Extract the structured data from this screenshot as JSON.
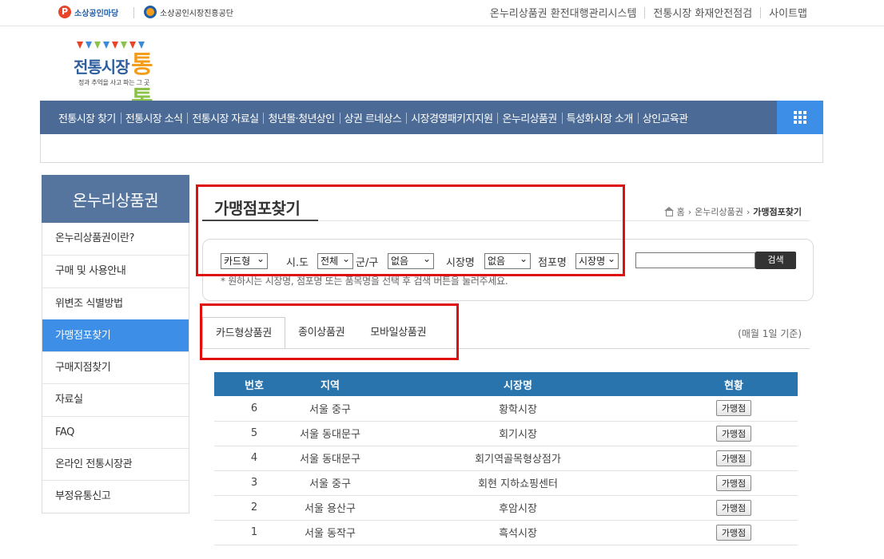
{
  "topbar": {
    "logo_a": "소상공인마당",
    "logo_b": "소상공인시장진흥공단",
    "links": [
      "온누리상품권 환전대행관리시스템",
      "전통시장 화재안전점검",
      "사이트맵"
    ]
  },
  "brand": {
    "name_a": "전통시장",
    "name_b1": "통",
    "name_b2": "통",
    "tagline": "정과 추억을 사고 파는 그 곳"
  },
  "gnb": {
    "items": [
      "전통시장 찾기",
      "전통시장 소식",
      "전통시장 자료실",
      "청년몰·청년상인",
      "상권 르네상스",
      "시장경영패키지지원",
      "온누리상품권",
      "특성화시장 소개",
      "상인교육관"
    ]
  },
  "lnb": {
    "title": "온누리상품권",
    "items": [
      "온누리상품권이란?",
      "구매 및 사용안내",
      "위변조 식별방법",
      "가맹점포찾기",
      "구매지점찾기",
      "자료실",
      "FAQ",
      "온라인 전통시장관",
      "부정유통신고"
    ],
    "active_index": 3
  },
  "page": {
    "title": "가맹점포찾기",
    "breadcrumb": {
      "home": "홈",
      "parent": "온누리상품권",
      "current": "가맹점포찾기"
    }
  },
  "search": {
    "type_value": "카드형",
    "sido_label": "시.도",
    "sido_value": "전체",
    "gungu_label": "군/구",
    "gungu_value": "없음",
    "market_label": "시장명",
    "market_value": "없음",
    "store_label": "점포명",
    "store_value": "시장명",
    "keyword": "",
    "button": "검색",
    "hint": "* 원하시는 시장명, 점포명 또는 품목명을 선택 후 검색 버튼을 눌러주세요."
  },
  "tabs": {
    "items": [
      "카드형상품권",
      "종이상품권",
      "모바일상품권"
    ],
    "active_index": 0,
    "basis": "(매월 1일 기준)"
  },
  "table": {
    "headers": [
      "번호",
      "지역",
      "시장명",
      "현황"
    ],
    "rows": [
      {
        "no": "6",
        "region": "서울 중구",
        "market": "황학시장",
        "action": "가맹점"
      },
      {
        "no": "5",
        "region": "서울 동대문구",
        "market": "회기시장",
        "action": "가맹점"
      },
      {
        "no": "4",
        "region": "서울 동대문구",
        "market": "회기역골목형상점가",
        "action": "가맹점"
      },
      {
        "no": "3",
        "region": "서울 중구",
        "market": "회현 지하쇼핑센터",
        "action": "가맹점"
      },
      {
        "no": "2",
        "region": "서울 용산구",
        "market": "후암시장",
        "action": "가맹점"
      },
      {
        "no": "1",
        "region": "서울 동작구",
        "market": "흑석시장",
        "action": "가맹점"
      }
    ]
  },
  "colors": {
    "gnb": "#4b6b96",
    "accent": "#3c8ee6",
    "table_head": "#2a74ad",
    "annotation": "#e01010"
  }
}
